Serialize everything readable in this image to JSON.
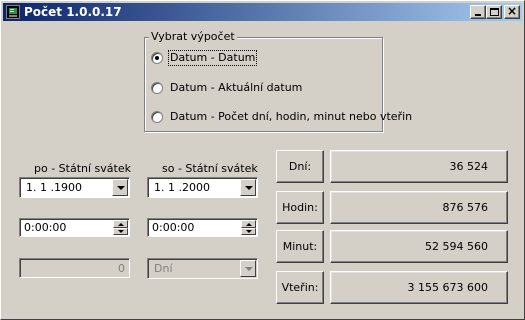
{
  "window": {
    "title": "Počet 1.0.0.17",
    "min_glyph": "",
    "max_glyph": "",
    "close_glyph": "×"
  },
  "mode_group": {
    "label": "Vybrat výpočet",
    "options": [
      {
        "label": "Datum - Datum",
        "selected": true
      },
      {
        "label": "Datum - Aktuální datum",
        "selected": false
      },
      {
        "label": "Datum - Počet dní, hodin, minut nebo vteřin",
        "selected": false
      }
    ]
  },
  "from": {
    "label": "po - Státní svátek",
    "date": "1. 1 .1900",
    "time": "0:00:00",
    "count": "0"
  },
  "to": {
    "label": "so - Státní svátek",
    "date": "1. 1 .2000",
    "time": "0:00:00",
    "unit": "Dní"
  },
  "results": [
    {
      "label": "Dní:",
      "value": "36 524"
    },
    {
      "label": "Hodin:",
      "value": "876 576"
    },
    {
      "label": "Minut:",
      "value": "52 594 560"
    },
    {
      "label": "Vteřin:",
      "value": "3 155 673 600"
    }
  ]
}
